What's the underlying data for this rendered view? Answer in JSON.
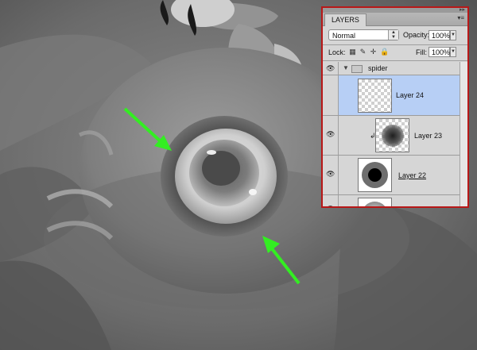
{
  "panel": {
    "tab_label": "LAYERS",
    "blend_mode": "Normal",
    "opacity_label": "Opacity:",
    "opacity_value": "100%",
    "lock_label": "Lock:",
    "fill_label": "Fill:",
    "fill_value": "100%",
    "group": {
      "name": "spider"
    },
    "layers": [
      {
        "name": "Layer 24",
        "selected": true,
        "visible": false
      },
      {
        "name": "Layer 23",
        "selected": false,
        "visible": true,
        "clipped": true
      },
      {
        "name": "Layer 22",
        "selected": false,
        "visible": true
      },
      {
        "name": "",
        "selected": false,
        "visible": true
      }
    ]
  },
  "annotations": {
    "arrow_color": "#33ee22",
    "arrows": [
      "arrow-pointing-down-right",
      "arrow-pointing-up-left"
    ]
  },
  "colors": {
    "selected_row": "#b7cff5",
    "panel_border": "#b81818"
  }
}
